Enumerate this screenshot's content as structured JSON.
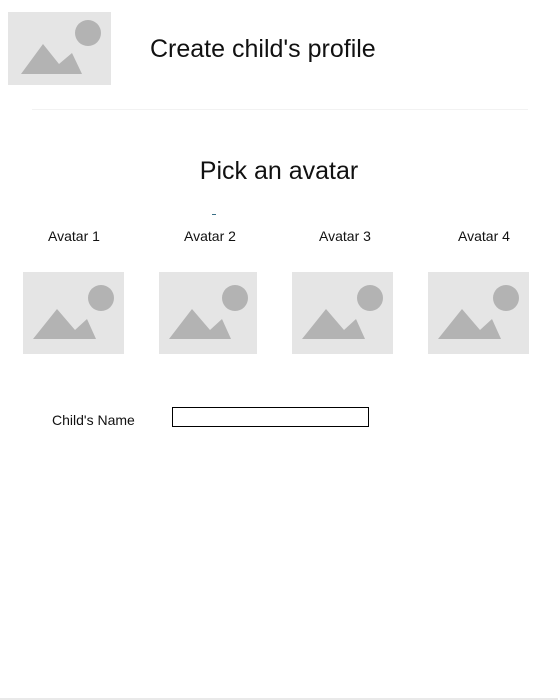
{
  "colors": {
    "placeholder_bg": "#e5e5e5",
    "placeholder_icon": "#b3b3b3",
    "divider": "#f2f2f2",
    "input_border": "#000000",
    "text": "#111111",
    "accent_mark": "#3a6f86"
  },
  "header": {
    "logo_icon": "image-placeholder-icon",
    "title": "Create child's profile"
  },
  "avatar_picker": {
    "title": "Pick an avatar",
    "avatars": [
      {
        "label": "Avatar 1",
        "image_icon": "image-placeholder-icon"
      },
      {
        "label": "Avatar 2",
        "image_icon": "image-placeholder-icon"
      },
      {
        "label": "Avatar 3",
        "image_icon": "image-placeholder-icon"
      },
      {
        "label": "Avatar 4",
        "image_icon": "image-placeholder-icon"
      }
    ]
  },
  "form": {
    "name_label": "Child's Name",
    "name_value": "",
    "name_placeholder": ""
  }
}
